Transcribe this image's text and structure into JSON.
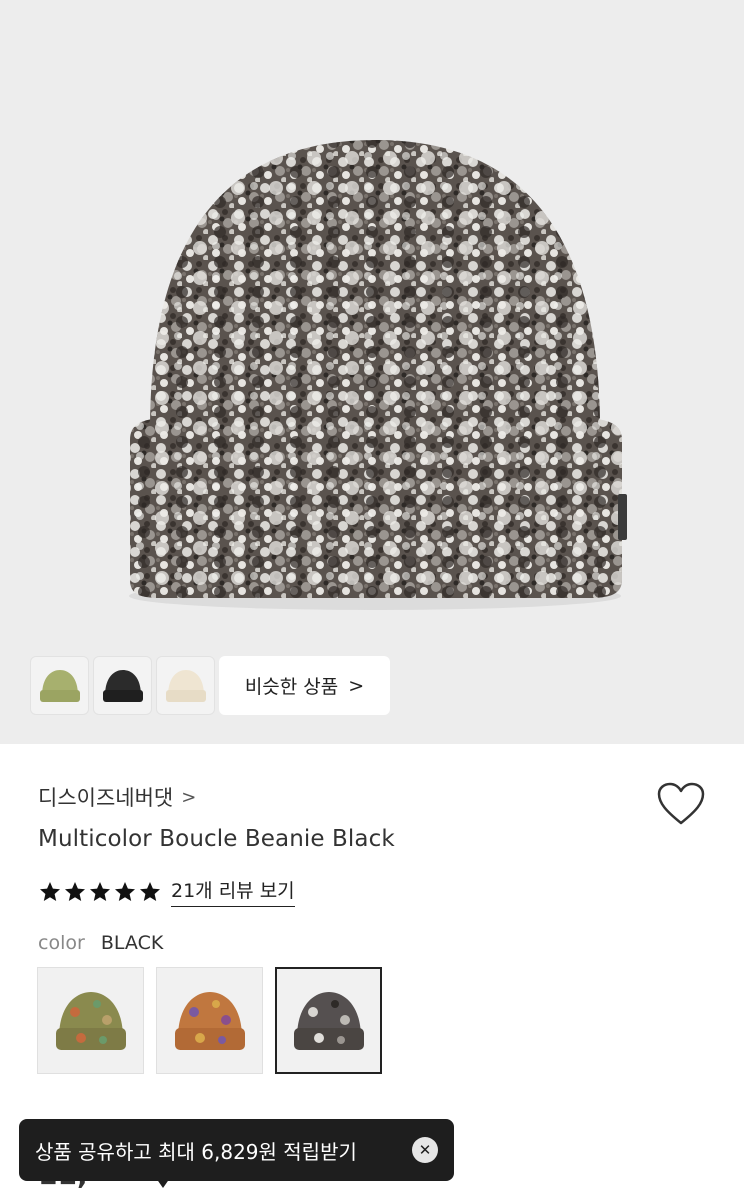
{
  "hero": {
    "thumbnails": [
      {
        "name": "olive-beanie",
        "color": "#a7b06e"
      },
      {
        "name": "black-beanie",
        "color": "#2b2b2b"
      },
      {
        "name": "cream-beanie",
        "color": "#efe5d2"
      }
    ],
    "similar_label": "비슷한 상품",
    "similar_chevron": ">"
  },
  "product": {
    "brand": "디스이즈네버댓",
    "brand_chevron": ">",
    "title": "Multicolor Boucle Beanie Black",
    "rating": 5,
    "review_link": "21개 리뷰 보기",
    "color_label": "color",
    "color_value": "BLACK",
    "options": [
      {
        "name": "green-multicolor",
        "color": "#8a8a4e"
      },
      {
        "name": "orange-multicolor",
        "color": "#c0773f"
      },
      {
        "name": "black-multicolor",
        "color": "#555050"
      }
    ],
    "selected_option": 2,
    "price_partial": "11,"
  },
  "toast": {
    "message": "상품 공유하고 최대 6,829원 적립받기",
    "close_icon": "close-icon"
  },
  "colors": {
    "hero_bg": "#ededed",
    "toast_bg": "#1e1e1e",
    "text": "#333333"
  }
}
